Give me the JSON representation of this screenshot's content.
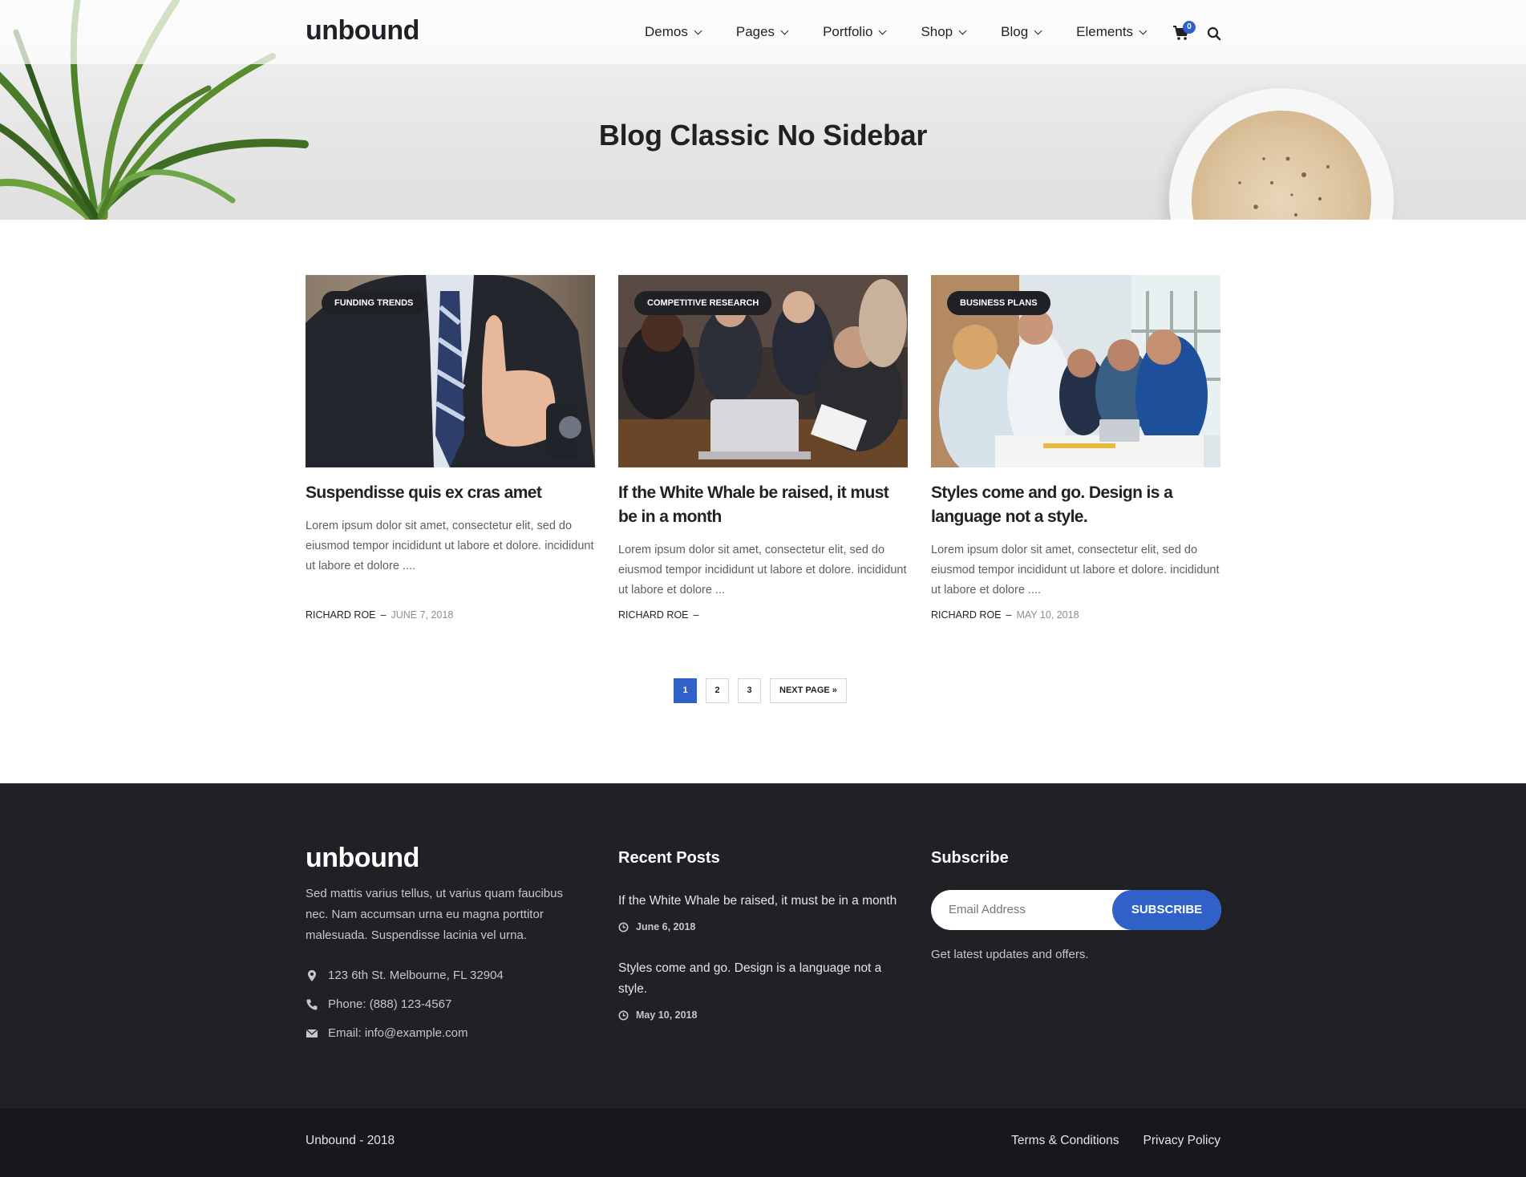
{
  "brand": {
    "logo": "unbound",
    "accent": "#2f61c9",
    "dark": "#1f2125"
  },
  "nav": {
    "items": [
      "Demos",
      "Pages",
      "Portfolio",
      "Shop",
      "Blog",
      "Elements"
    ],
    "cart_count": "0",
    "cart_icon": "cart-icon",
    "search_icon": "search-icon"
  },
  "hero": {
    "title": "Blog Classic No Sidebar"
  },
  "posts": [
    {
      "tag": "FUNDING TRENDS",
      "title": "Suspendisse quis ex cras amet",
      "excerpt": "Lorem ipsum dolor sit amet, consectetur elit, sed do eiusmod tempor incididunt ut labore et dolore. incididunt ut labore et dolore ....",
      "author": "RICHARD ROE",
      "date": "JUNE 7, 2018"
    },
    {
      "tag": "COMPETITIVE RESEARCH",
      "title": "If the White Whale be raised, it must be in a month",
      "excerpt": "Lorem ipsum dolor sit amet, consectetur elit, sed do eiusmod tempor incididunt ut labore et dolore. incididunt ut labore et dolore ...",
      "author": "RICHARD ROE",
      "date": ""
    },
    {
      "tag": "BUSINESS PLANS",
      "title": "Styles come and go. Design is a language not a style.",
      "excerpt": "Lorem ipsum dolor sit amet, consectetur elit, sed do eiusmod tempor incididunt ut labore et dolore. incididunt ut labore et dolore ....",
      "author": "RICHARD ROE",
      "date": "MAY 10, 2018"
    }
  ],
  "pagination": {
    "pages": [
      "1",
      "2",
      "3"
    ],
    "current": "1",
    "next": "NEXT PAGE »"
  },
  "footer": {
    "logo": "unbound",
    "about": "Sed mattis varius tellus, ut varius quam faucibus nec. Nam accumsan urna eu magna porttitor malesuada. Suspendisse lacinia vel urna.",
    "address": "123 6th St. Melbourne, FL 32904",
    "phone": "Phone: (888) 123-4567",
    "email": "Email: info@example.com",
    "recent_heading": "Recent Posts",
    "recent": [
      {
        "title": "If the White Whale be raised, it must be in a month",
        "date": "June 6, 2018"
      },
      {
        "title": "Styles come and go. Design is a language not a style.",
        "date": "May 10, 2018"
      }
    ],
    "subscribe_heading": "Subscribe",
    "subscribe_placeholder": "Email Address",
    "subscribe_button": "SUBSCRIBE",
    "subscribe_note": "Get latest updates and offers."
  },
  "bottom": {
    "copyright": "Unbound - 2018",
    "links": [
      "Terms & Conditions",
      "Privacy Policy"
    ]
  }
}
